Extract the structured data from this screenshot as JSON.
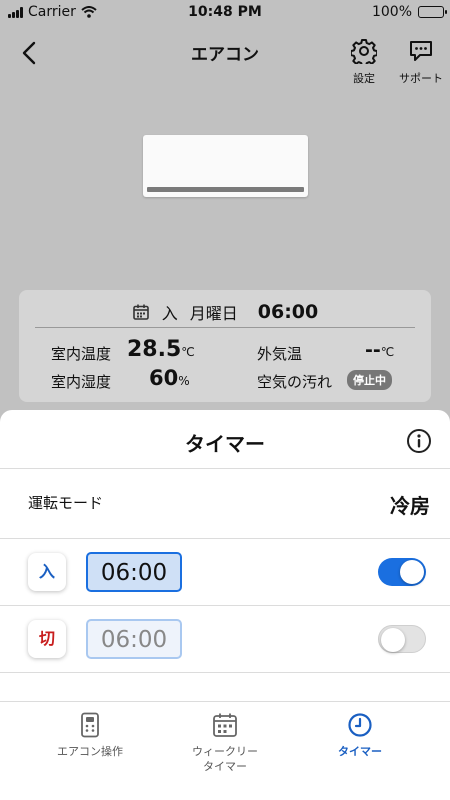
{
  "status_bar": {
    "carrier": "Carrier",
    "time": "10:48 PM",
    "battery": "100%"
  },
  "header": {
    "title": "エアコン",
    "settings_label": "設定",
    "support_label": "サポート"
  },
  "info_card": {
    "day_label": "入",
    "weekday": "月曜日",
    "time": "06:00",
    "indoor_temp_label": "室内温度",
    "indoor_temp_value": "28.5",
    "indoor_temp_unit": "℃",
    "outdoor_temp_label": "外気温",
    "outdoor_temp_value": "--",
    "outdoor_temp_unit": "℃",
    "indoor_humidity_label": "室内湿度",
    "indoor_humidity_value": "60",
    "indoor_humidity_unit": "%",
    "air_dirt_label": "空気の汚れ",
    "air_dirt_status": "停止中"
  },
  "sheet": {
    "title": "タイマー",
    "mode_label": "運転モード",
    "mode_value": "冷房",
    "timer_on": {
      "tag": "入",
      "time": "06:00",
      "enabled": true
    },
    "timer_off": {
      "tag": "切",
      "time": "06:00",
      "enabled": false
    }
  },
  "tabs": [
    {
      "label": "エアコン操作",
      "icon": "remote-icon",
      "active": false
    },
    {
      "label": "ウィークリー\nタイマー",
      "icon": "calendar-icon",
      "active": false
    },
    {
      "label": "タイマー",
      "icon": "clock-icon",
      "active": true
    }
  ],
  "colors": {
    "accent": "#1a6fe0",
    "on_tag": "#1a5fc2",
    "off_tag": "#c81e1e",
    "backdrop": "#c1c1c1"
  }
}
